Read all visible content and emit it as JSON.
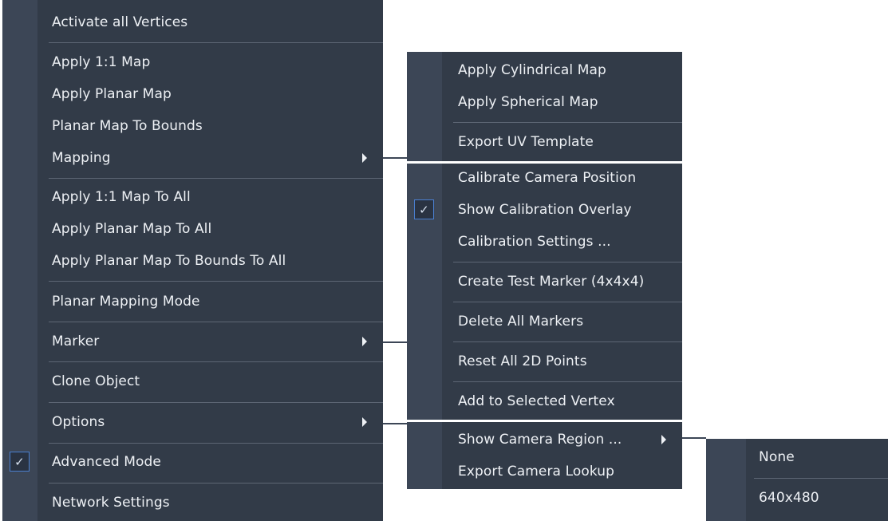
{
  "main_menu": {
    "items": [
      {
        "label": "Activate all Vertices"
      },
      {
        "label": "Apply 1:1 Map"
      },
      {
        "label": "Apply Planar Map"
      },
      {
        "label": "Planar Map To Bounds"
      },
      {
        "label": "Mapping",
        "submenu": true
      },
      {
        "label": "Apply 1:1 Map To All"
      },
      {
        "label": "Apply Planar Map To All"
      },
      {
        "label": "Apply Planar Map To Bounds To All"
      },
      {
        "label": "Planar Mapping Mode"
      },
      {
        "label": "Marker",
        "submenu": true
      },
      {
        "label": "Clone Object"
      },
      {
        "label": "Options",
        "submenu": true
      },
      {
        "label": "Advanced Mode",
        "checked": true
      },
      {
        "label": "Network Settings"
      }
    ]
  },
  "mapping_submenu": {
    "items": [
      {
        "label": "Apply Cylindrical Map"
      },
      {
        "label": "Apply Spherical Map"
      },
      {
        "label": "Export UV Template"
      }
    ]
  },
  "marker_submenu": {
    "items": [
      {
        "label": "Calibrate Camera Position"
      },
      {
        "label": "Show Calibration Overlay",
        "checked": true
      },
      {
        "label": "Calibration Settings ..."
      },
      {
        "label": "Create Test Marker (4x4x4)"
      },
      {
        "label": "Delete All Markers"
      },
      {
        "label": "Reset All 2D Points"
      },
      {
        "label": "Add to Selected Vertex"
      }
    ]
  },
  "options_submenu": {
    "items": [
      {
        "label": "Show Camera Region ...",
        "submenu": true
      },
      {
        "label": "Export Camera Lookup"
      }
    ]
  },
  "camera_region_submenu": {
    "items": [
      {
        "label": "None"
      },
      {
        "label": "640x480"
      }
    ]
  },
  "colors": {
    "menu_bg": "#323b48",
    "gutter_bg": "#3c4656",
    "separator": "#5d6674",
    "check_border": "#4a7fd0",
    "text": "#eef1f5"
  },
  "icons": {
    "check": "checkmark-icon",
    "submenu_arrow": "triangle-right-icon"
  }
}
